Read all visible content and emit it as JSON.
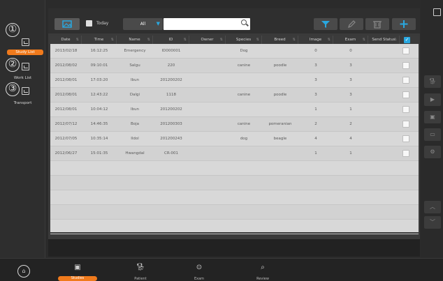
{
  "sidebar": {
    "steps": [
      {
        "num": "①",
        "label": "Study List",
        "active": true
      },
      {
        "num": "②",
        "label": "Work List",
        "active": false
      },
      {
        "num": "③",
        "label": "Transport",
        "active": false
      }
    ]
  },
  "toolbar": {
    "today_label": "Today",
    "filter_value": "All",
    "search_value": "",
    "search_placeholder": ""
  },
  "table": {
    "columns": [
      "Date",
      "Time",
      "Name",
      "ID",
      "Owner",
      "Species",
      "Breed",
      "Image",
      "Exam",
      "Send Status"
    ],
    "rows": [
      [
        "2013/02/18",
        "16:12:25",
        "Emergency",
        "ID000001",
        "",
        "Dog",
        "",
        "0",
        "0",
        ""
      ],
      [
        "2012/08/02",
        "09:10:01",
        "Salgu",
        "220",
        "",
        "canine",
        "poodle",
        "3",
        "3",
        ""
      ],
      [
        "2012/08/01",
        "17:03:20",
        "Ibun",
        "201200202",
        "",
        "",
        "",
        "3",
        "3",
        ""
      ],
      [
        "2012/08/01",
        "12:43:22",
        "Dalgi",
        "1118",
        "",
        "canine",
        "poodle",
        "3",
        "3",
        ""
      ],
      [
        "2012/08/01",
        "10:04:12",
        "Ibun",
        "201200202",
        "",
        "",
        "",
        "1",
        "1",
        ""
      ],
      [
        "2012/07/12",
        "14:46:35",
        "Boja",
        "201200303",
        "",
        "canine",
        "pomeranian",
        "2",
        "2",
        ""
      ],
      [
        "2012/07/05",
        "10:35:14",
        "Ildol",
        "201200243",
        "",
        "dog",
        "beagle",
        "4",
        "4",
        ""
      ],
      [
        "2012/06/27",
        "15:01:35",
        "Hwangdal",
        "CR-001",
        "",
        "",
        "",
        "1",
        "1",
        ""
      ]
    ]
  },
  "bottom_nav": {
    "items": [
      {
        "label": "Studies",
        "icon": "image-icon",
        "active": true
      },
      {
        "label": "Patient",
        "icon": "dog-icon",
        "active": false
      },
      {
        "label": "Exam",
        "icon": "play-icon",
        "active": false
      },
      {
        "label": "Review",
        "icon": "magnify-image-icon",
        "active": false
      }
    ]
  },
  "colors": {
    "accent_orange": "#f07a1c",
    "accent_blue": "#29a8e0"
  }
}
